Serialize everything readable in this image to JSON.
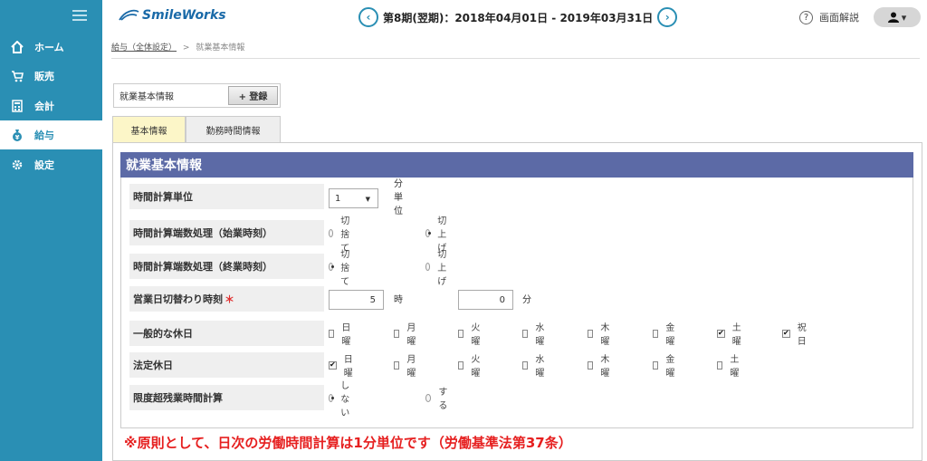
{
  "sidebar": {
    "items": [
      {
        "label": "ホーム",
        "icon": "home-icon"
      },
      {
        "label": "販売",
        "icon": "cart-icon"
      },
      {
        "label": "会計",
        "icon": "calculator-icon"
      },
      {
        "label": "給与",
        "icon": "money-bag-icon"
      },
      {
        "label": "設定",
        "icon": "gear-icon"
      }
    ],
    "active_index": 3
  },
  "header": {
    "logo": "SmileWorks",
    "period": "第8期(翌期)：2018年04月01日 - 2019年03月31日",
    "prev": "‹",
    "next": "›",
    "help_icon_glyph": "?",
    "help_label": "画面解説",
    "user_glyph": "▾"
  },
  "breadcrumb": {
    "parent": "給与（全体設定）",
    "separator": ">",
    "current": "就業基本情報"
  },
  "title_input": {
    "value": "就業基本情報"
  },
  "register_button": "+ 登録",
  "tabs": [
    {
      "label": "基本情報"
    },
    {
      "label": "勤務時間情報"
    }
  ],
  "section_title": "就業基本情報",
  "rows": {
    "time_unit": {
      "label": "時間計算単位",
      "value": "1",
      "unit": "分単位"
    },
    "start_rounding": {
      "label": "時間計算端数処理（始業時刻）",
      "options": [
        "切捨て",
        "切上げ"
      ],
      "selected": 1
    },
    "end_rounding": {
      "label": "時間計算端数処理（終業時刻）",
      "options": [
        "切捨て",
        "切上げ"
      ],
      "selected": 0
    },
    "day_switch": {
      "label": "営業日切替わり時刻",
      "required": "＊",
      "hour": "5",
      "hour_unit": "時",
      "minute": "0",
      "minute_unit": "分"
    },
    "general_holiday": {
      "label": "一般的な休日",
      "days": [
        "日曜",
        "月曜",
        "火曜",
        "水曜",
        "木曜",
        "金曜",
        "土曜",
        "祝日"
      ],
      "checked": [
        false,
        false,
        false,
        false,
        false,
        false,
        true,
        true
      ]
    },
    "legal_holiday": {
      "label": "法定休日",
      "days": [
        "日曜",
        "月曜",
        "火曜",
        "水曜",
        "木曜",
        "金曜",
        "土曜"
      ],
      "checked": [
        true,
        false,
        false,
        false,
        false,
        false,
        false
      ]
    },
    "overtime_limit": {
      "label": "限度超残業時間計算",
      "options": [
        "しない",
        "する"
      ],
      "selected": 0
    }
  },
  "note": "※原則として、日次の労働時間計算は1分単位です（労働基準法第37条）",
  "check_glyph": "✔"
}
